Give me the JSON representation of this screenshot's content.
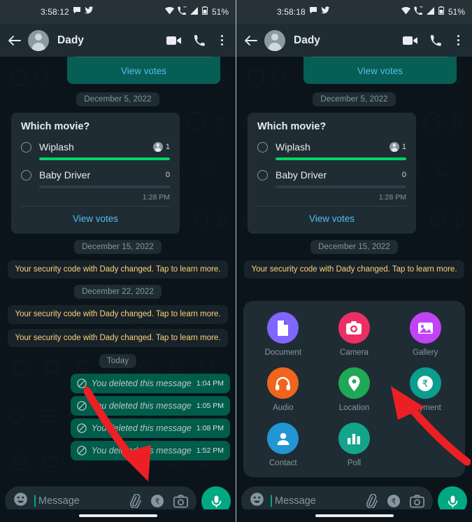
{
  "panels": [
    {
      "status": {
        "time": "3:58:12",
        "battery": "51%",
        "icons": [
          "chat-bubble-icon",
          "twitter-icon",
          "wifi-icon",
          "missed-call-icon",
          "signal-icon",
          "battery-icon"
        ]
      },
      "header": {
        "title": "Dady",
        "back": "back-arrow-icon",
        "video": "video-call-icon",
        "call": "phone-call-icon",
        "menu": "overflow-menu-icon"
      },
      "messages": {
        "top_poll_view_votes": "View votes",
        "date_1": "December 5, 2022",
        "poll": {
          "question": "Which movie?",
          "options": [
            {
              "label": "Wiplash",
              "count": "1",
              "percent": 100,
              "has_avatar": true
            },
            {
              "label": "Baby Driver",
              "count": "0",
              "percent": 0,
              "has_avatar": false
            }
          ],
          "time": "1:28 PM",
          "view_votes": "View votes"
        },
        "date_2": "December 15, 2022",
        "security_1": "Your security code with Dady changed. Tap to learn more.",
        "date_3": "December 22, 2022",
        "security_2": "Your security code with Dady changed. Tap to learn more.",
        "security_3": "Your security code with Dady changed. Tap to learn more.",
        "date_4": "Today",
        "deleted": [
          {
            "text": "You deleted this message",
            "time": "1:04 PM"
          },
          {
            "text": "You deleted this message",
            "time": "1:05 PM"
          },
          {
            "text": "You deleted this message",
            "time": "1:08 PM"
          },
          {
            "text": "You deleted this message",
            "time": "1:52 PM"
          }
        ]
      },
      "input": {
        "placeholder": "Message",
        "emoji": "emoji-icon",
        "attach": "paperclip-attach-icon",
        "payment": "rupee-payment-icon",
        "camera": "camera-icon",
        "mic": "microphone-icon"
      },
      "attachment_sheet_visible": false,
      "arrow": {
        "visible": true,
        "points_to": "paperclip-attach-icon"
      }
    },
    {
      "status": {
        "time": "3:58:18",
        "battery": "51%",
        "icons": [
          "chat-bubble-icon",
          "twitter-icon",
          "wifi-icon",
          "missed-call-icon",
          "signal-icon",
          "battery-icon"
        ]
      },
      "header": {
        "title": "Dady",
        "back": "back-arrow-icon",
        "video": "video-call-icon",
        "call": "phone-call-icon",
        "menu": "overflow-menu-icon"
      },
      "messages": {
        "top_poll_view_votes": "View votes",
        "date_1": "December 5, 2022",
        "poll": {
          "question": "Which movie?",
          "options": [
            {
              "label": "Wiplash",
              "count": "1",
              "percent": 100,
              "has_avatar": true
            },
            {
              "label": "Baby Driver",
              "count": "0",
              "percent": 0,
              "has_avatar": false
            }
          ],
          "time": "1:28 PM",
          "view_votes": "View votes"
        },
        "date_2": "December 15, 2022",
        "security_1": "Your security code with Dady changed. Tap to learn more.",
        "date_3": "",
        "security_2": "",
        "security_3": "",
        "date_4": "",
        "deleted": []
      },
      "input": {
        "placeholder": "Message",
        "emoji": "emoji-icon",
        "attach": "paperclip-attach-icon",
        "payment": "rupee-payment-icon",
        "camera": "camera-icon",
        "mic": "microphone-icon"
      },
      "attachment_sheet_visible": true,
      "arrow": {
        "visible": true,
        "points_to": "location-attachment"
      }
    }
  ],
  "attachment_sheet": {
    "items": [
      {
        "label": "Document",
        "icon": "document-icon",
        "color": "#7f66ff"
      },
      {
        "label": "Camera",
        "icon": "camera-icon",
        "color": "#eb2f64"
      },
      {
        "label": "Gallery",
        "icon": "gallery-image-icon",
        "color": "#c044f5"
      },
      {
        "label": "Audio",
        "icon": "headphones-audio-icon",
        "color": "#f0641e"
      },
      {
        "label": "Location",
        "icon": "location-pin-icon",
        "color": "#1fa855"
      },
      {
        "label": "Payment",
        "icon": "rupee-payment-icon",
        "color": "#0b9d8e"
      },
      {
        "label": "Contact",
        "icon": "contact-person-icon",
        "color": "#2196d3"
      },
      {
        "label": "Poll",
        "icon": "poll-bars-icon",
        "color": "#12a58c"
      }
    ]
  },
  "colors": {
    "app_background": "#0b141a",
    "header_background": "#1f2c33",
    "outgoing_bubble": "#005c4b",
    "outgoing_poll_bubble": "#075e54",
    "incoming_card": "#1f2c33",
    "link_blue": "#53bdeb",
    "accent_green": "#00a884",
    "meter_green": "#00d563",
    "system_message_text": "#ffd279",
    "arrow_red": "#ec2024"
  }
}
